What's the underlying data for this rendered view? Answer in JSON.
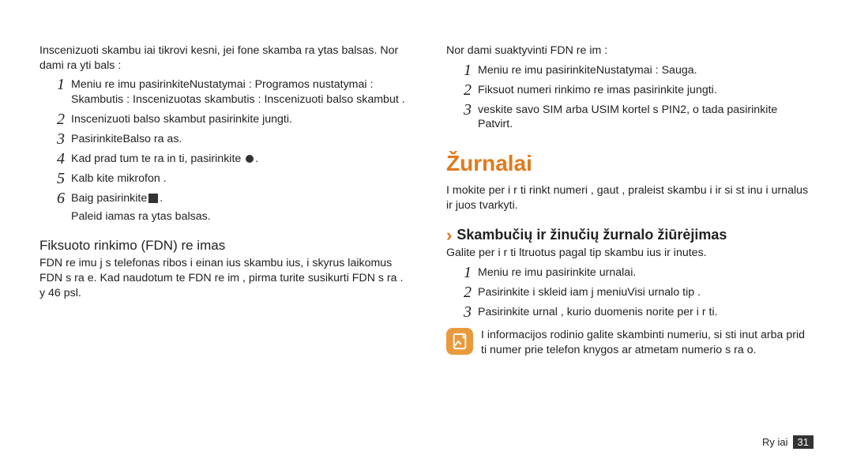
{
  "left": {
    "intro": "Inscenizuoti skambu iai tikrovi kesni, jei fone skamba  ra ytas balsas. Nor dami  ra yti bals :",
    "steps": [
      "Meniu re imu pasirinkiteNustatymai  :  Programos nustatymai  :  Skambutis  :  Inscenizuotas skambutis  : Inscenizuoti balso skambut .",
      "Inscenizuoti balso skambut  pasirinkite  jungti.",
      "PasirinkiteBalso  ra as.",
      "Kad prad tum te  ra in ti, pasirinkite ",
      "Kalb kite   mikrofon .",
      "Baig  pasirinkite"
    ],
    "after": "Paleid iamas  ra ytas balsas.",
    "subhead": "Fiksuoto rinkimo (FDN) re imas",
    "fdn": "FDN re imu j s  telefonas ribos i einan ius skambu ius, i skyrus laikomus FDN s ra e. Kad naudotum te FDN re im , pirma turite susikurti FDN s ra  . y  46 psl."
  },
  "right": {
    "intro": "Nor dami suaktyvinti FDN re im :",
    "steps": [
      "Meniu re imu pasirinkiteNustatymai  :  Sauga.",
      "Fiksuot  numeri  rinkimo re imas\t pasirinkite  jungti.",
      " veskite savo SIM arba USIM kortel s PIN2, o tada pasirinkite Patvirt."
    ],
    "section": "Žurnalai",
    "sectdesc": "I mokite per i r ti rinkt  numeri , gaut , praleist  skambu i  ir si st   inu i   urnalus ir juos tvarkyti.",
    "chev": "Skambučių ir žinučių žurnalo žiūrėjimas",
    "chevdesc": "Galite per i r ti  ltruotus pagal tip  skambu ius ir  inutes.",
    "steps2": [
      "Meniu re imu pasirinkite urnalai.",
      "Pasirinkite i skleid iam j  meniuVisi  urnalo tip .",
      "Pasirinkite  urnal , kurio duomenis norite per i r ti."
    ],
    "note": "I  informacijos rodinio galite skambinti numeriu, si sti  inut  arba prid ti numer  prie telefon  knygos ar atmetam  numerio s ra o."
  },
  "footer": {
    "label": "Ry iai",
    "page": "31"
  }
}
